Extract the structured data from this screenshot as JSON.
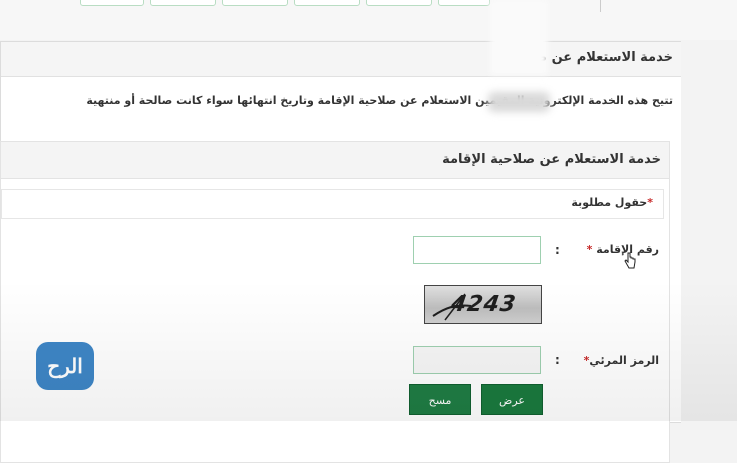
{
  "page": {
    "title": "خدمة الاستعلام عن صلا",
    "description": "تتيح هذه الخدمة الإلكترونية      المقيمين الاستعلام عن صلاحية الإقامة وتاريخ انتهائها سواء كانت صالحة أو منتهية"
  },
  "form": {
    "title": "خدمة الاستعلام عن صلاحية الإقامة",
    "required_note": "حقول مطلوبة",
    "required_marker": "*",
    "iqama_label": "رقم الإقامة",
    "captcha_label": "الرمز المرئي",
    "colon": ":",
    "iqama_value": "",
    "captcha_value": "",
    "captcha_image_text": "4243"
  },
  "buttons": {
    "show": "عرض",
    "clear": "مسح"
  },
  "logo": {
    "text": "الرح"
  },
  "colors": {
    "accent_green": "#1a7a3e",
    "field_border": "#9ed0b0",
    "required_red": "#c62828"
  }
}
